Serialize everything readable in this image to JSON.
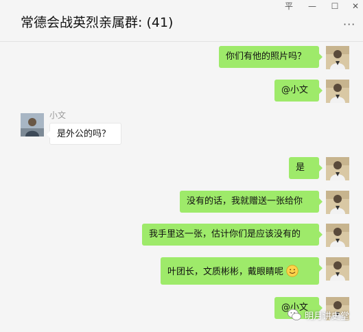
{
  "window": {
    "title": "常德会战英烈亲属群: (41)",
    "controls": {
      "pin": "平",
      "minimize": "—",
      "maximize": "☐",
      "close": "✕"
    },
    "more": "···"
  },
  "chat": {
    "messages": [
      {
        "direction": "out",
        "text": "你们有他的照片吗？"
      },
      {
        "direction": "out",
        "text": "@小文"
      },
      {
        "direction": "in",
        "sender": "小文",
        "text": "是外公的吗？"
      },
      {
        "direction": "out",
        "text": "是"
      },
      {
        "direction": "out",
        "text": "没有的话，我就赠送一张给你"
      },
      {
        "direction": "out",
        "text": "我手里这一张，估计你们是应该没有的"
      },
      {
        "direction": "out",
        "text": "叶团长，文质彬彬，戴眼睛呢",
        "emoji": "smile-emoji"
      },
      {
        "direction": "out",
        "text": "@小文"
      }
    ]
  },
  "watermark": {
    "text": "明月讲史堂"
  },
  "colors": {
    "outgoing_bubble": "#9eea6a",
    "incoming_bubble": "#ffffff",
    "background": "#f5f5f5"
  }
}
